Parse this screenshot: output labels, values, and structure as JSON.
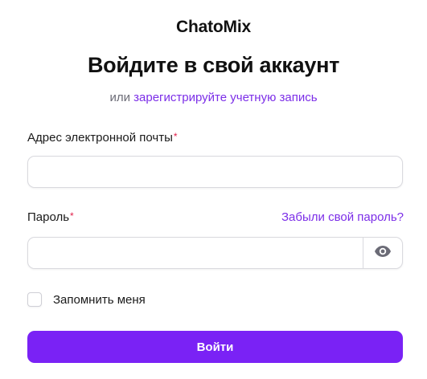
{
  "brand": "ChatoMix",
  "title": "Войдите в свой аккаунт",
  "subtitle": {
    "prefix": "или",
    "link": "зарегистрируйте учетную запись"
  },
  "email": {
    "label": "Адрес электронной почты",
    "required_mark": "*",
    "value": "",
    "placeholder": ""
  },
  "password": {
    "label": "Пароль",
    "required_mark": "*",
    "value": "",
    "placeholder": "",
    "toggle_icon": "eye-icon"
  },
  "forgot_link": "Забыли свой пароль?",
  "remember": {
    "label": "Запомнить меня",
    "checked": false
  },
  "submit_label": "Войти",
  "colors": {
    "accent": "#7a22f5",
    "link": "#7c2ee8",
    "required": "#e11d48",
    "muted": "#6b6b76"
  }
}
